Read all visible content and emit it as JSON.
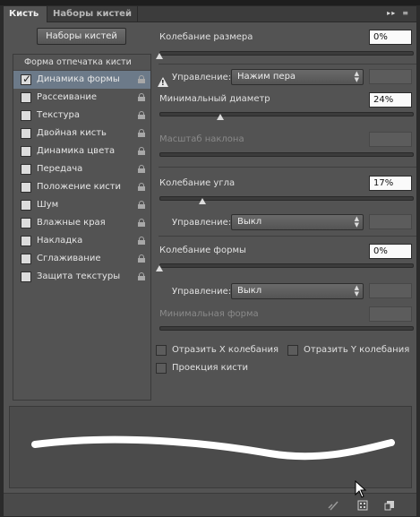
{
  "tabs": [
    {
      "label": "Кисть",
      "active": true
    },
    {
      "label": "Наборы кистей",
      "active": false
    }
  ],
  "presets_button": "Наборы кистей",
  "list": {
    "header": "Форма отпечатка кисти",
    "items": [
      {
        "label": "Динамика формы",
        "checked": true,
        "selected": true
      },
      {
        "label": "Рассеивание",
        "checked": false
      },
      {
        "label": "Текстура",
        "checked": false
      },
      {
        "label": "Двойная кисть",
        "checked": false
      },
      {
        "label": "Динамика цвета",
        "checked": false
      },
      {
        "label": "Передача",
        "checked": false
      },
      {
        "label": "Положение кисти",
        "checked": false
      },
      {
        "label": "Шум",
        "checked": false
      },
      {
        "label": "Влажные края",
        "checked": false
      },
      {
        "label": "Накладка",
        "checked": false
      },
      {
        "label": "Сглаживание",
        "checked": false
      },
      {
        "label": "Защита текстуры",
        "checked": false
      }
    ]
  },
  "size_jitter": {
    "label": "Колебание размера",
    "value": "0%"
  },
  "size_control": {
    "label": "Управление:",
    "value": "Нажим пера"
  },
  "min_diameter": {
    "label": "Минимальный диаметр",
    "value": "24%"
  },
  "tilt_scale": {
    "label": "Масштаб наклона"
  },
  "angle_jitter": {
    "label": "Колебание угла",
    "value": "17%"
  },
  "angle_control": {
    "label": "Управление:",
    "value": "Выкл"
  },
  "roundness_jitter": {
    "label": "Колебание формы",
    "value": "0%"
  },
  "roundness_control": {
    "label": "Управление:",
    "value": "Выкл"
  },
  "min_roundness": {
    "label": "Минимальная форма"
  },
  "flip_x": {
    "label": "Отразить X колебания",
    "checked": false
  },
  "flip_y": {
    "label": "Отразить Y колебания",
    "checked": false
  },
  "brush_projection": {
    "label": "Проекция кисти",
    "checked": false
  },
  "colors": {
    "panel": "#535353",
    "selected": "#6c7a89",
    "stroke": "#ffffff"
  }
}
